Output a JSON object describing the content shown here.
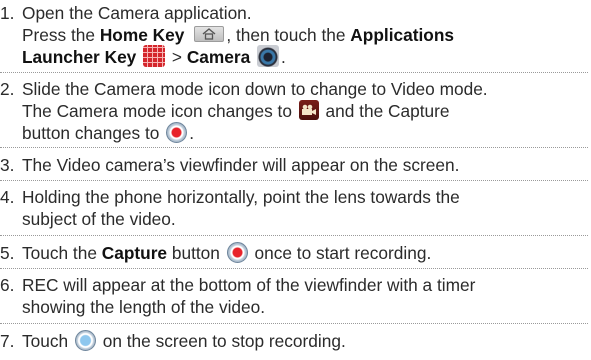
{
  "steps": [
    {
      "number": "1.",
      "lines": [
        {
          "text": "Open the Camera application."
        },
        {
          "pre": "Press the ",
          "key1": "Home Key",
          "post": ", then touch the ",
          "key2": "Applications"
        },
        {
          "key1": "Launcher Key",
          "post": " > ",
          "key2": "Camera"
        }
      ]
    },
    {
      "number": "2.",
      "lines": [
        {
          "text": "Slide the Camera mode icon down to change to Video mode."
        },
        {
          "pre": "The Camera mode icon changes to ",
          "post": " and the Capture"
        },
        {
          "pre": "button changes to ",
          "post": "."
        }
      ]
    },
    {
      "number": "3.",
      "lines": [
        {
          "text": "The Video camera’s viewfinder will appear on the screen."
        }
      ]
    },
    {
      "number": "4.",
      "lines": [
        {
          "text": "Holding the phone horizontally, point the lens towards the"
        },
        {
          "text": "subject of the video."
        }
      ]
    },
    {
      "number": "5.",
      "lines": [
        {
          "pre": "Touch the ",
          "key1": "Capture",
          "post": " button ",
          "tail": " once to start recording."
        }
      ]
    },
    {
      "number": "6.",
      "lines": [
        {
          "text": "REC will appear at the bottom of the viewfinder with a timer"
        },
        {
          "text": "showing the length of the video."
        }
      ]
    },
    {
      "number": "7.",
      "lines": [
        {
          "pre": "Touch ",
          "post": " on the screen to stop recording."
        }
      ]
    }
  ],
  "icons": {
    "home": "home-key-icon",
    "apps": "applications-launcher-icon",
    "camera": "camera-app-icon",
    "video_mode": "video-camera-mode-icon",
    "record": "record-button-icon",
    "stop": "stop-record-button-icon"
  },
  "colors": {
    "text": "#2b2b2b",
    "record_red": "#e8232a",
    "launcher_red": "#d4262c",
    "rule": "#9a9a9a"
  }
}
